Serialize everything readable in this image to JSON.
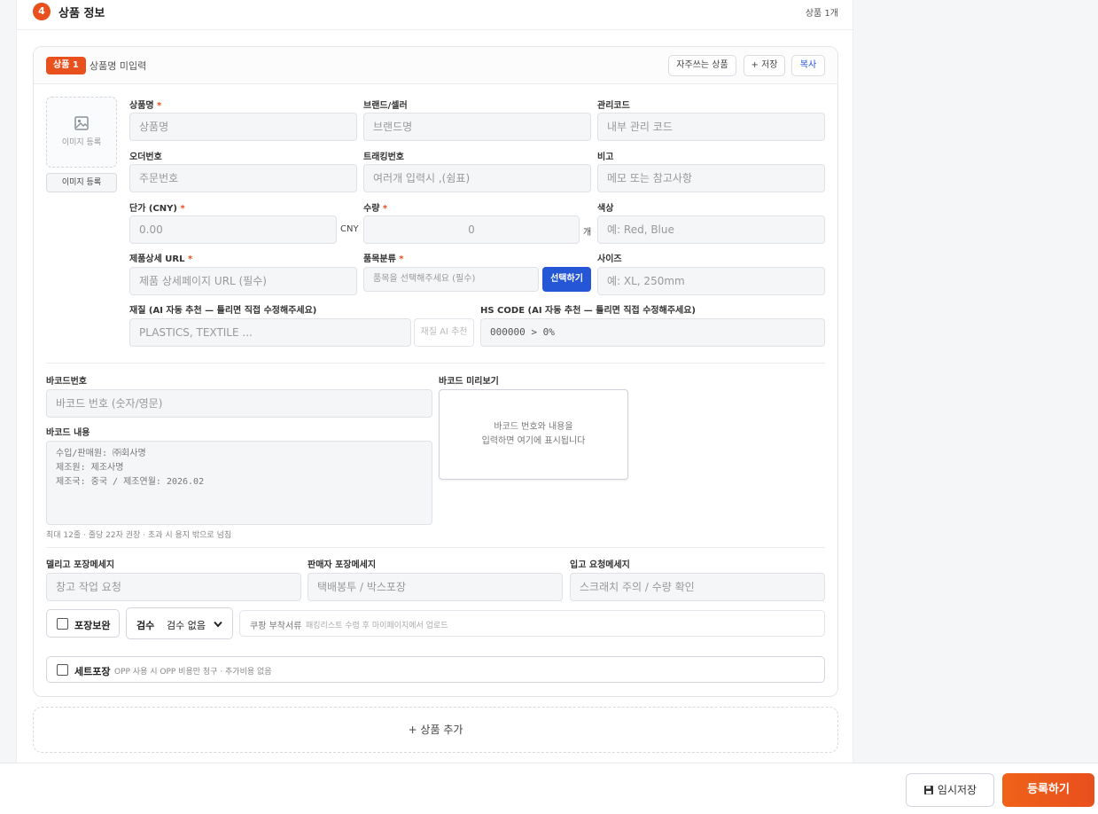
{
  "section": {
    "number": "4",
    "title": "상품 정보",
    "count": "상품 1개"
  },
  "product": {
    "badge": "상품 1",
    "name_status": "상품명 미입력",
    "actions": {
      "favorites": "자주쓰는 상품",
      "save": "+ 저장",
      "copy": "복사"
    },
    "image": {
      "box_label": "이미지 등록",
      "button_label": "이미지 등록"
    },
    "fields": {
      "product_name": {
        "label": "상품명",
        "required": "*",
        "placeholder": "상품명"
      },
      "brand": {
        "label": "브랜드/셀러",
        "placeholder": "브랜드명"
      },
      "manage_code": {
        "label": "관리코드",
        "placeholder": "내부 관리 코드"
      },
      "order_no": {
        "label": "오더번호",
        "placeholder": "주문번호"
      },
      "tracking_no": {
        "label": "트래킹번호",
        "placeholder": "여러개 입력시 ,(쉼표)"
      },
      "note": {
        "label": "비고",
        "placeholder": "메모 또는 참고사항"
      },
      "unit_price": {
        "label": "단가 (CNY)",
        "required": "*",
        "value": "0.00",
        "unit": "CNY"
      },
      "quantity": {
        "label": "수량",
        "required": "*",
        "value": "0",
        "unit": "개"
      },
      "color": {
        "label": "색상",
        "placeholder": "예: Red, Blue"
      },
      "detail_url": {
        "label": "제품상세 URL",
        "required": "*",
        "placeholder": "제품 상세페이지 URL (필수)"
      },
      "category": {
        "label": "품목분류",
        "required": "*",
        "placeholder": "품목을 선택해주세요 (필수)",
        "button": "선택하기"
      },
      "size": {
        "label": "사이즈",
        "placeholder": "예: XL, 250mm"
      },
      "material": {
        "label": "재질 (AI 자동 추천 — 틀리면 직접 수정해주세요)",
        "placeholder": "PLASTICS, TEXTILE ...",
        "ai_button": "재질 AI 추천"
      },
      "hs_code": {
        "label": "HS CODE (AI 자동 추천 — 틀리면 직접 수정해주세요)",
        "value": "000000 > 0%"
      }
    },
    "barcode": {
      "number_label": "바코드번호",
      "number_placeholder": "바코드 번호 (숫자/영문)",
      "preview_label": "바코드 미리보기",
      "preview_line1": "바코드 번호와 내용을",
      "preview_line2": "입력하면 여기에 표시됩니다",
      "content_label": "바코드 내용",
      "content_lines": [
        "수입/판매원: ㈜회사명",
        "제조원: 제조사명",
        "제조국: 중국 / 제조연월: 2026.02"
      ],
      "hint": "최대 12줄 · 줄당 22자 권장 · 초과 시 용지 밖으로 넘침"
    },
    "messages": {
      "warehouse_label": "델리고 포장메세지",
      "warehouse_placeholder": "창고 작업 요청",
      "seller_label": "판매자 포장메세지",
      "seller_placeholder": "택배봉투 / 박스포장",
      "inbound_label": "입고 요청메세지",
      "inbound_placeholder": "스크래치 주의 / 수량 확인"
    },
    "options": {
      "packing_reinforce": "포장보완",
      "inspection_label": "검수",
      "inspection_value": "검수 없음",
      "coupang_label": "쿠팡 부착서류",
      "coupang_hint": "패킹리스트 수령 후 마이페이지에서 업로드",
      "set_packing": "세트포장",
      "set_packing_hint": "OPP 사용 시 OPP 비용만 청구 · 추가비용 없음"
    }
  },
  "add_product": "+ 상품 추가",
  "footer": {
    "temp_save": "임시저장",
    "register": "등록하기"
  },
  "colors": {
    "accent": "#e8501d",
    "primary_blue": "#2456d6"
  }
}
